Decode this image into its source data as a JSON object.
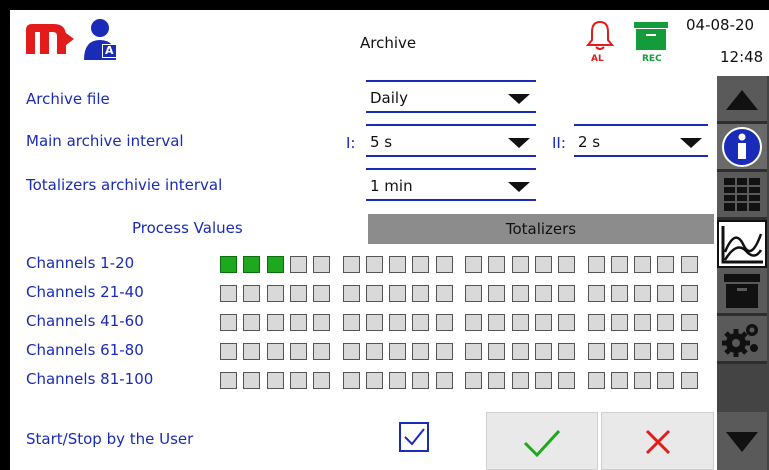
{
  "header": {
    "title": "Archive",
    "date": "04-08-20",
    "time": "12:48",
    "alarm_label": "AL",
    "rec_label": "REC",
    "user_badge": "A"
  },
  "form": {
    "archive_file_label": "Archive file",
    "archive_file_value": "Daily",
    "main_interval_label": "Main archive interval",
    "interval1_prefix": "I:",
    "interval1_value": "5 s",
    "interval2_prefix": "II:",
    "interval2_value": "2 s",
    "totalizers_interval_label": "Totalizers archivie interval",
    "totalizers_interval_value": "1 min"
  },
  "tabs": {
    "process_values": "Process Values",
    "totalizers": "Totalizers"
  },
  "channels": [
    {
      "label": "Channels 1-20",
      "active": [
        1,
        2,
        3
      ]
    },
    {
      "label": "Channels 21-40",
      "active": []
    },
    {
      "label": "Channels 41-60",
      "active": []
    },
    {
      "label": "Channels 61-80",
      "active": []
    },
    {
      "label": "Channels 81-100",
      "active": []
    }
  ],
  "footer": {
    "start_stop_label": "Start/Stop by the User",
    "start_stop_checked": true
  },
  "colors": {
    "accent": "#1a2bb8",
    "active_channel": "#1ea81e",
    "alarm": "#e31b1b",
    "rec": "#149c3a"
  }
}
